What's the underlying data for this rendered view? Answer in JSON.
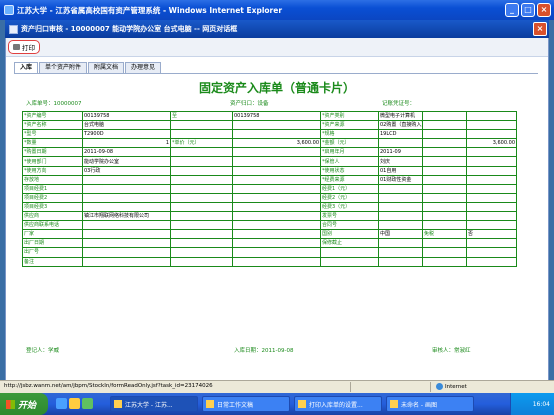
{
  "window": {
    "title": "江苏大学 - 江苏省属高校国有资产管理系统 - Windows Internet Explorer",
    "btn_min": "_",
    "btn_max": "□",
    "btn_close": "×"
  },
  "dialog": {
    "title": "资产归口审核 - 10000007  能动学院办公室  台式电脑  -- 网页对话框",
    "close": "×"
  },
  "toolbar": {
    "print_label": "打印"
  },
  "tabs": [
    "入库",
    "单个资产附件",
    "附属文档",
    "办理意见"
  ],
  "form": {
    "title": "固定资产入库单（普通卡片）",
    "meta": {
      "doc_no": "入库单号：10000007",
      "dept": "资产归口：设备",
      "voucher": "记账凭证号："
    },
    "footer": {
      "registrar": "登记人：学威",
      "date": "入库日期：2011-09-08",
      "auditor": "审核人：常淑红"
    },
    "rows": [
      [
        "*资产编号",
        "00139758",
        "至",
        "00139758",
        "*资产类别",
        "微型电子计算机",
        "",
        ""
      ],
      [
        "*资产名称",
        "台式电脑",
        "",
        "",
        "*资产来源",
        "02购置（直接购入）",
        "",
        ""
      ],
      [
        "*型号",
        "T2900D",
        "",
        "",
        "*规格",
        "19LCD",
        "",
        ""
      ],
      [
        "*数量",
        "1",
        "*单价（元）",
        "3,600.00",
        "*金额（元）",
        "",
        "",
        "3,600.00"
      ],
      [
        "*购置日期",
        "2011-09-08",
        "",
        "",
        "*启用年月",
        "2011-09",
        "",
        ""
      ],
      [
        "*使用部门",
        "能动学院办公室",
        "",
        "",
        "*保管人",
        "刘庆",
        "",
        ""
      ],
      [
        "*使用方向",
        "03行政",
        "",
        "",
        "*使用状态",
        "01自用",
        "",
        ""
      ],
      [
        "存放地",
        "",
        "",
        "",
        "*经费来源",
        "01财政性资金",
        "",
        ""
      ],
      [
        "项目经费1",
        "",
        "",
        "",
        "经费1（元）",
        "",
        "",
        ""
      ],
      [
        "项目经费2",
        "",
        "",
        "",
        "经费2（元）",
        "",
        "",
        ""
      ],
      [
        "项目经费3",
        "",
        "",
        "",
        "经费3（元）",
        "",
        "",
        ""
      ],
      [
        "供应商",
        "镇江市翔联网络科技有限公司",
        "",
        "",
        "发票号",
        "",
        "",
        ""
      ],
      [
        "供应商联系电话",
        "",
        "",
        "",
        "合同号",
        "",
        "",
        ""
      ],
      [
        "厂家",
        "",
        "",
        "",
        "国别",
        "中国",
        "免税",
        "否"
      ],
      [
        "出厂日期",
        "",
        "",
        "",
        "保修截止",
        "",
        "",
        ""
      ],
      [
        "出厂号",
        "",
        "",
        "",
        "",
        "",
        "",
        ""
      ],
      [
        "备注",
        "",
        "",
        "",
        "",
        "",
        "",
        ""
      ]
    ]
  },
  "status": {
    "url": "http://jsbz.wanm.net/am/jbpm/StockIn/formReadOnly.jsf?task_id=23174026",
    "zone": "Internet"
  },
  "taskbar": {
    "start": "开始",
    "tasks": [
      "江苏大学 - 江苏...",
      "日常工作文稿",
      "打印入库单的设置...",
      "未命名 - 画图"
    ],
    "clock": "16:04"
  }
}
